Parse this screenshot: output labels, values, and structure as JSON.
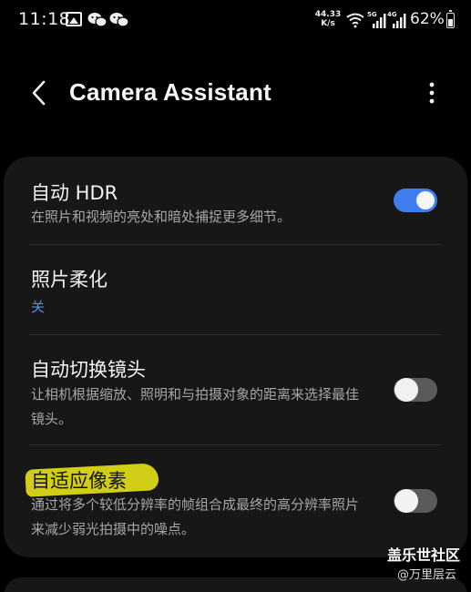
{
  "status_bar": {
    "time": "11:18",
    "net_speed_value": "44.33",
    "net_speed_unit": "K/s",
    "signal1_label": "5G",
    "signal2_label": "4G",
    "battery": "62%",
    "icons": [
      "gallery-icon",
      "wechat-icon",
      "wechat-icon",
      "wifi-icon",
      "signal-icon",
      "signal-icon",
      "battery-icon"
    ]
  },
  "app_bar": {
    "title": "Camera Assistant",
    "icons": [
      "back-icon",
      "more-options-icon"
    ]
  },
  "settings": [
    {
      "title": "自动 HDR",
      "description": "在照片和视频的亮处和暗处捕捉更多细节。",
      "toggle": true
    },
    {
      "title": "照片柔化",
      "value": "关"
    },
    {
      "title": "自动切换镜头",
      "description": "让相机根据缩放、照明和与拍摄对象的距离来选择最佳镜头。",
      "toggle": false
    },
    {
      "title": "自适应像素",
      "description": "通过将多个较低分辨率的帧组合成最终的高分辨率照片来减少弱光拍摄中的噪点。",
      "toggle": false
    }
  ],
  "colors": {
    "accent": "#3e7ef0",
    "value_text": "#5b8fea",
    "card_bg": "#171717",
    "highlight": "#f3ef19"
  },
  "watermark": {
    "brand": "盖乐世社区",
    "user": "@万里层云"
  }
}
